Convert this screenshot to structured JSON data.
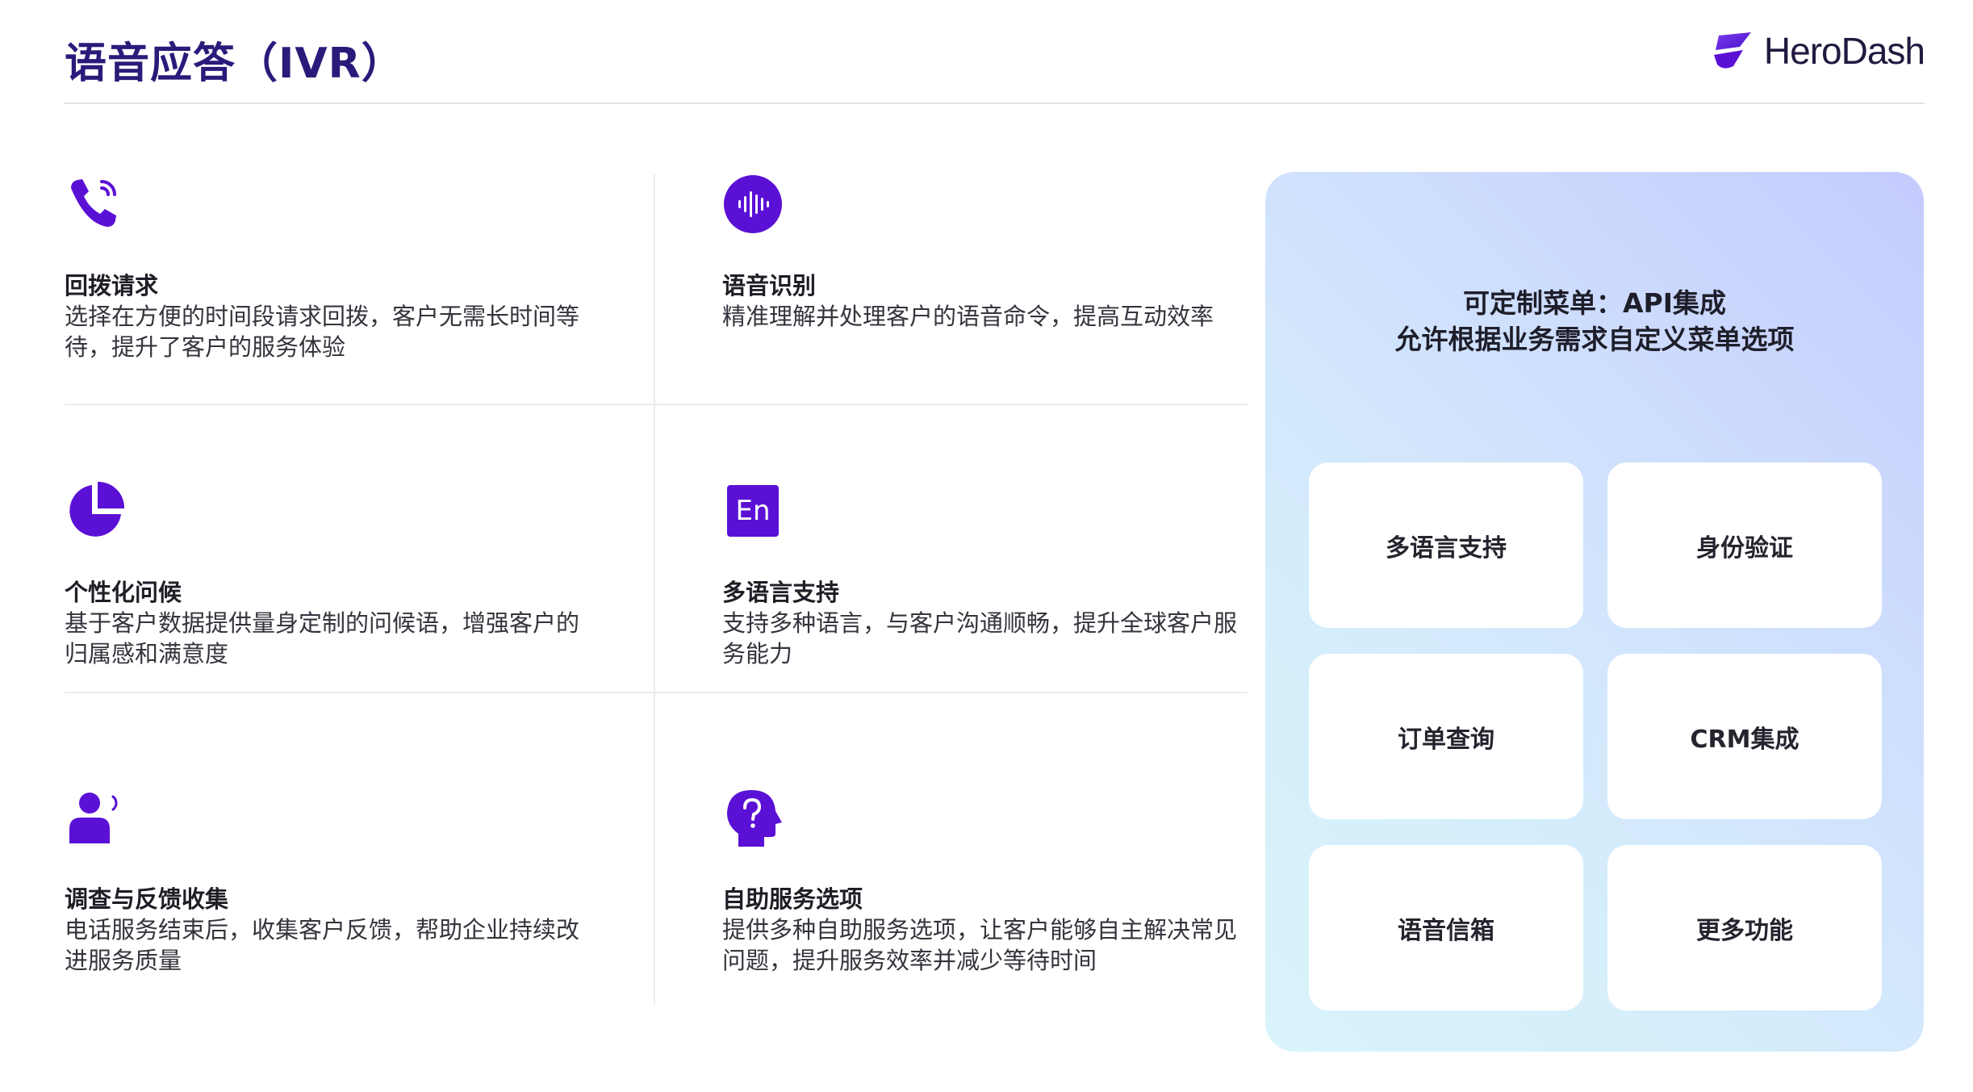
{
  "header": {
    "title": "语音应答（IVR）",
    "logo_text": "HeroDash"
  },
  "colors": {
    "brand": "#5b10d6",
    "title": "#2b1a7a",
    "panel_from": "#c4cbfd",
    "panel_to": "#d9f4fa"
  },
  "features": [
    {
      "icon": "phone-callback-icon",
      "title": "回拨请求",
      "desc": "选择在方便的时间段请求回拨，客户无需长时间等待，提升了客户的服务体验"
    },
    {
      "icon": "voice-waveform-icon",
      "title": "语音识别",
      "desc": "精准理解并处理客户的语音命令，提高互动效率"
    },
    {
      "icon": "pie-chart-icon",
      "title": "个性化问候",
      "desc": "基于客户数据提供量身定制的问候语，增强客户的归属感和满意度"
    },
    {
      "icon": "language-en-icon",
      "icon_text": "En",
      "title": "多语言支持",
      "desc": "支持多种语言，与客户沟通顺畅，提升全球客户服务能力"
    },
    {
      "icon": "user-speaking-icon",
      "title": "调查与反馈收集",
      "desc": "电话服务结束后，收集客户反馈，帮助企业持续改进服务质量"
    },
    {
      "icon": "head-question-icon",
      "title": "自助服务选项",
      "desc": "提供多种自助服务选项，让客户能够自主解决常见问题，提升服务效率并减少等待时间"
    }
  ],
  "panel": {
    "title_line1": "可定制菜单：API集成",
    "title_line2": "允许根据业务需求自定义菜单选项",
    "options": [
      "多语言支持",
      "身份验证",
      "订单查询",
      "CRM集成",
      "语音信箱",
      "更多功能"
    ]
  }
}
